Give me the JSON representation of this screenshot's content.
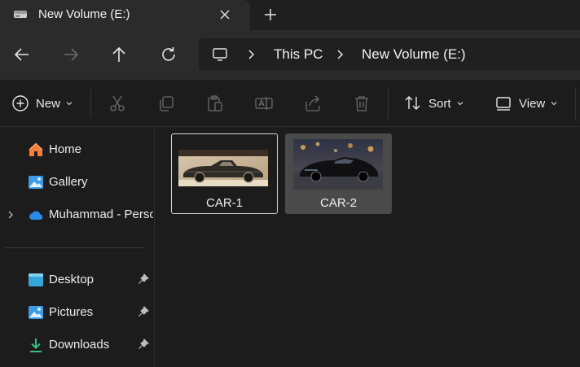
{
  "tab": {
    "title": "New Volume (E:)",
    "icon": "drive-icon"
  },
  "nav": {
    "back": "back-arrow-icon",
    "forward": "forward-arrow-icon",
    "up": "up-arrow-icon",
    "refresh": "refresh-icon"
  },
  "address": {
    "crumbs": [
      "This PC",
      "New Volume (E:)"
    ]
  },
  "toolbar": {
    "new_label": "New",
    "sort_label": "Sort",
    "view_label": "View"
  },
  "sidebar": {
    "items": [
      {
        "label": "Home",
        "icon": "home-icon"
      },
      {
        "label": "Gallery",
        "icon": "gallery-icon"
      },
      {
        "label": "Muhammad - Perso",
        "icon": "onedrive-icon"
      },
      {
        "label": "Desktop",
        "icon": "desktop-icon",
        "pinned": true
      },
      {
        "label": "Pictures",
        "icon": "pictures-icon",
        "pinned": true
      },
      {
        "label": "Downloads",
        "icon": "downloads-icon",
        "pinned": true
      }
    ]
  },
  "files": [
    {
      "name": "CAR-1",
      "state": "focused"
    },
    {
      "name": "CAR-2",
      "state": "selected"
    }
  ],
  "colors": {
    "accent": "#4cc2ff",
    "selection": "#4a4a4a",
    "background": "#1c1c1c"
  }
}
